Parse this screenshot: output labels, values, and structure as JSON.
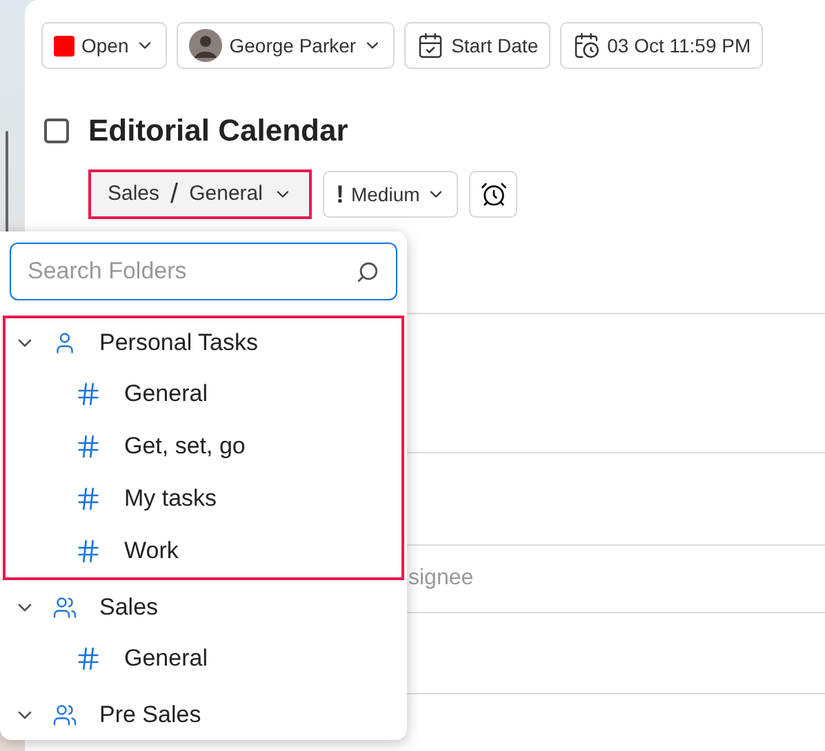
{
  "toolbar": {
    "status": {
      "label": "Open",
      "color": "#ff0000"
    },
    "assignee": {
      "name": "George Parker"
    },
    "start_date": {
      "label": "Start Date"
    },
    "due_date": {
      "label": "03 Oct 11:59 PM"
    }
  },
  "task": {
    "checked": false,
    "title": "Editorial Calendar"
  },
  "folder_button": {
    "project": "Sales",
    "separator": "/",
    "folder": "General",
    "highlighted": true
  },
  "priority_button": {
    "icon": "!",
    "label": "Medium"
  },
  "background_fields": [
    {
      "placeholder": "signee"
    }
  ],
  "folder_menu": {
    "search": {
      "placeholder": "Search Folders"
    },
    "groups": [
      {
        "name": "Personal Tasks",
        "kind": "personal",
        "expanded": true,
        "highlighted": true,
        "children": [
          {
            "name": "General"
          },
          {
            "name": "Get, set, go"
          },
          {
            "name": "My tasks"
          },
          {
            "name": "Work"
          }
        ]
      },
      {
        "name": "Sales",
        "kind": "team",
        "expanded": true,
        "highlighted": false,
        "children": [
          {
            "name": "General"
          }
        ]
      },
      {
        "name": "Pre Sales",
        "kind": "team",
        "expanded": true,
        "highlighted": false
      }
    ]
  }
}
